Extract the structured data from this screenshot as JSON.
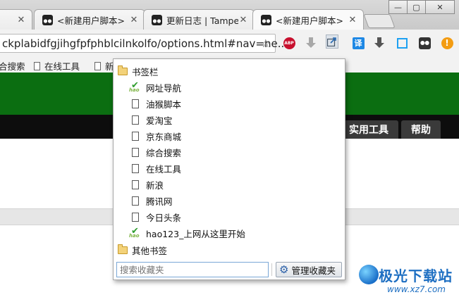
{
  "window": {
    "minimize_glyph": "—",
    "maximize_glyph": "▢",
    "close_glyph": "✕"
  },
  "tabs": [
    {
      "title": "",
      "icon": "tab-close-only",
      "close": "✕"
    },
    {
      "title": "<新建用户脚本>",
      "icon": "tampermonkey-icon",
      "close": "✕"
    },
    {
      "title": "更新日志 | Tampe",
      "icon": "tampermonkey-icon",
      "close": "✕"
    },
    {
      "title": "<新建用户脚本>",
      "icon": "tampermonkey-icon",
      "close": "✕"
    }
  ],
  "omnibox": {
    "url": "ckplabidfgjihgfpfphblcilnkolfo/options.html#nav=ne..."
  },
  "extensions": {
    "abp_label": "ABP",
    "translate_label": "译",
    "warning_label": "!"
  },
  "bookmarks_bar": {
    "items": [
      "合搜索",
      "在线工具",
      "新"
    ]
  },
  "page": {
    "nav": [
      "实用工具",
      "帮助"
    ]
  },
  "bookmark_menu": {
    "folder_title": "书签栏",
    "items": [
      {
        "label": "网址导航",
        "icon": "hao123-icon"
      },
      {
        "label": "油猴脚本",
        "icon": "page-icon"
      },
      {
        "label": "爱淘宝",
        "icon": "page-icon"
      },
      {
        "label": "京东商城",
        "icon": "page-icon"
      },
      {
        "label": "综合搜索",
        "icon": "page-icon"
      },
      {
        "label": "在线工具",
        "icon": "page-icon"
      },
      {
        "label": "新浪",
        "icon": "page-icon"
      },
      {
        "label": "腾讯网",
        "icon": "page-icon"
      },
      {
        "label": "今日头条",
        "icon": "page-icon"
      },
      {
        "label": "hao123_上网从这里开始",
        "icon": "hao123-icon"
      }
    ],
    "other_folder": "其他书签",
    "search_placeholder": "搜索收藏夹",
    "manage_label": "管理收藏夹"
  },
  "watermark": {
    "brand": "极光下载站",
    "site": "www.xz7.com"
  },
  "colors": {
    "header_green": "#0b6e11",
    "nav_black": "#0d0d0d",
    "accent_blue": "#1e6fc2"
  }
}
